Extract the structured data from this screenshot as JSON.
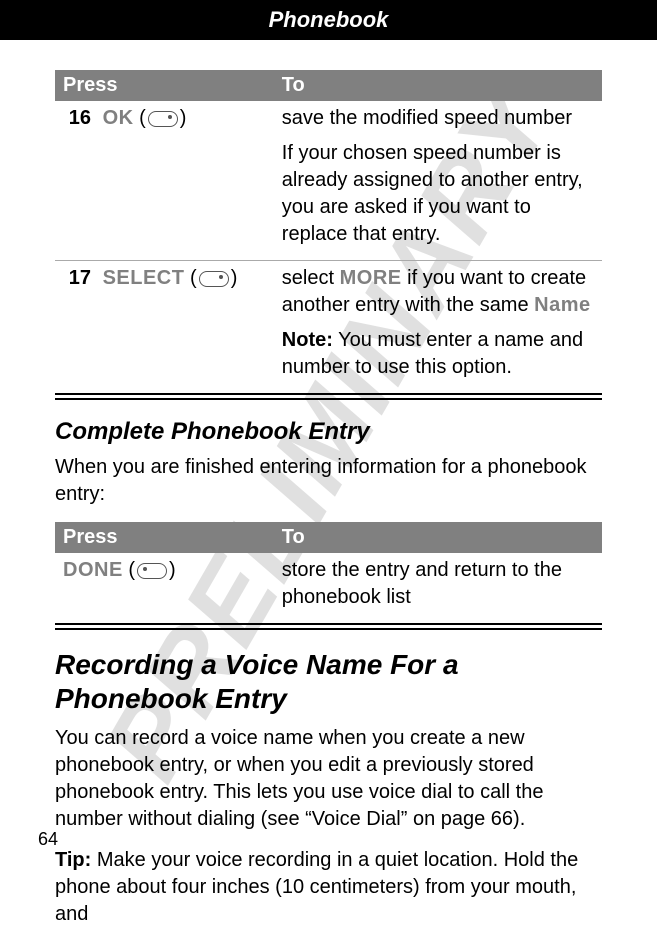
{
  "header": {
    "title": "Phonebook"
  },
  "watermark": "PRELIMINARY",
  "table1": {
    "headers": {
      "press": "Press",
      "to": "To"
    },
    "rows": [
      {
        "num": "16",
        "key": "OK",
        "desc1": "save the modified speed number",
        "desc2": "If your chosen speed number is already assigned to another entry, you are asked if you want to replace that entry."
      },
      {
        "num": "17",
        "key": "SELECT",
        "desc1a": "select ",
        "desc1b": "MORE",
        "desc1c": " if you want to create another entry with the same ",
        "desc1d": "Name",
        "noteLabel": "Note:",
        "noteText": " You must enter a name and number to use this option."
      }
    ]
  },
  "section1": {
    "heading": "Complete Phonebook Entry",
    "intro": "When you are finished entering information for a phonebook entry:"
  },
  "table2": {
    "headers": {
      "press": "Press",
      "to": "To"
    },
    "rows": [
      {
        "key": "DONE",
        "desc": "store the entry and return to the phonebook list"
      }
    ]
  },
  "section2": {
    "heading": "Recording a Voice Name For a Phonebook Entry",
    "para1": "You can record a voice name when you create a new phonebook entry, or when you edit a previously stored phonebook entry. This lets you use voice dial to call the number without dialing (see “Voice Dial” on page 66).",
    "tipLabel": "Tip:",
    "tipText": " Make your voice recording in a quiet location. Hold the phone about four inches (10 centimeters) from your mouth, and"
  },
  "pageNumber": "64"
}
